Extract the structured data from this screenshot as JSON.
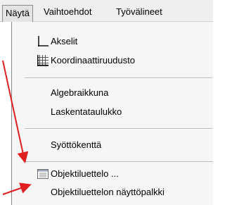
{
  "menubar": {
    "items": [
      {
        "label": "Näytä"
      },
      {
        "label": "Vaihtoehdot"
      },
      {
        "label": "Työvälineet"
      }
    ]
  },
  "menu": {
    "items": [
      {
        "label": "Akselit",
        "icon": "axes-icon"
      },
      {
        "label": "Koordinaattiruudusto",
        "icon": "grid-icon"
      },
      {
        "label": "Algebraikkuna"
      },
      {
        "label": "Laskentataulukko"
      },
      {
        "label": "Syöttökenttä"
      },
      {
        "label": "Objektiluettelo ...",
        "icon": "list-icon"
      },
      {
        "label": "Objektiluettelon näyttöpalkki"
      }
    ]
  },
  "colors": {
    "arrow": "#e02020"
  }
}
